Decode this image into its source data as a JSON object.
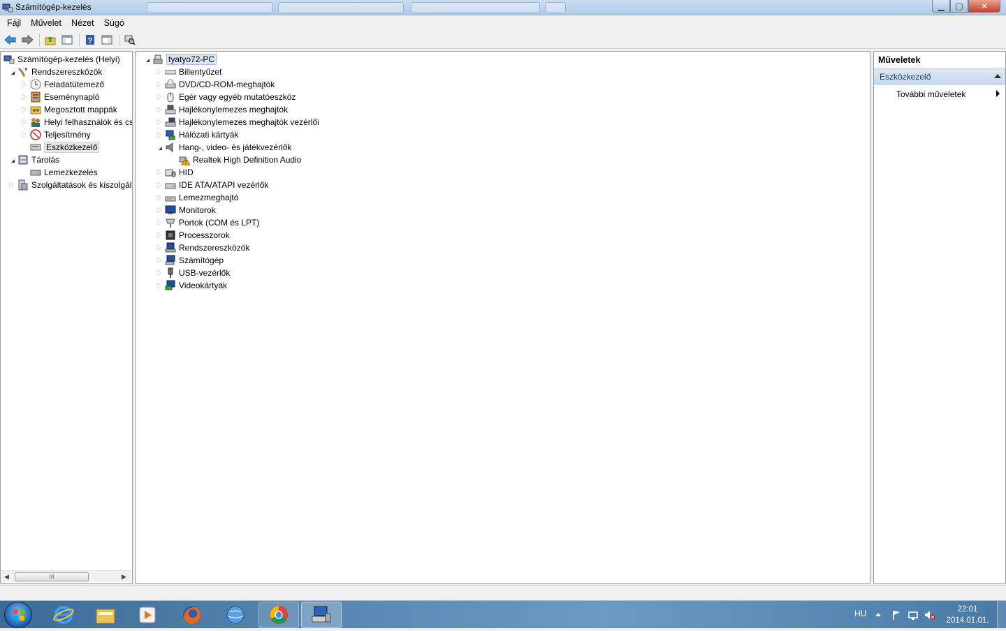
{
  "window": {
    "title": "Számítógép-kezelés",
    "min_glyph": "▁",
    "max_glyph": "▢",
    "close_glyph": "✕"
  },
  "menu": [
    "Fájl",
    "Művelet",
    "Nézet",
    "Súgó"
  ],
  "toolbar": {
    "buttons": [
      "back-icon",
      "forward-icon",
      "up-folder-icon",
      "show-hide-console-tree-icon",
      "help-icon",
      "show-hide-action-pane-icon",
      "properties-scan-icon"
    ]
  },
  "left_tree": {
    "items": [
      {
        "label": "Számítógép-kezelés (Helyi)",
        "icon": "computer-management-icon"
      },
      {
        "label": "Rendszereszközök",
        "icon": "system-tools-icon"
      },
      {
        "label": "Feladatütemező",
        "icon": "task-scheduler-icon"
      },
      {
        "label": "Eseménynapló",
        "icon": "event-viewer-icon"
      },
      {
        "label": "Megosztott mappák",
        "icon": "shared-folders-icon"
      },
      {
        "label": "Helyi felhasználók és cs",
        "icon": "local-users-icon"
      },
      {
        "label": "Teljesítmény",
        "icon": "performance-icon"
      },
      {
        "label": "Eszközkezelő",
        "icon": "device-manager-icon"
      },
      {
        "label": "Tárolás",
        "icon": "storage-icon"
      },
      {
        "label": "Lemezkezelés",
        "icon": "disk-management-icon"
      },
      {
        "label": "Szolgáltatások és kiszolgáló",
        "icon": "services-icon"
      }
    ],
    "scroll_thumb": "III"
  },
  "device_tree": {
    "root": "tyatyo72-PC",
    "items": [
      {
        "label": "Billentyűzet",
        "icon": "keyboard-icon"
      },
      {
        "label": "DVD/CD-ROM-meghajtók",
        "icon": "dvd-drive-icon"
      },
      {
        "label": "Egér vagy egyéb mutatóeszköz",
        "icon": "mouse-icon"
      },
      {
        "label": "Hajlékonylemezes meghajtók",
        "icon": "floppy-drive-icon"
      },
      {
        "label": "Hajlékonylemezes meghajtók vezérlői",
        "icon": "floppy-controller-icon"
      },
      {
        "label": "Hálózati kártyák",
        "icon": "network-adapter-icon"
      },
      {
        "label": "Hang-, video- és játékvezérlők",
        "icon": "sound-icon"
      },
      {
        "label": "Realtek High Definition Audio",
        "icon": "warning-icon"
      },
      {
        "label": "HID",
        "icon": "hid-icon"
      },
      {
        "label": "IDE ATA/ATAPI vezérlők",
        "icon": "ide-controller-icon"
      },
      {
        "label": "Lemezmeghajtó",
        "icon": "disk-drive-icon"
      },
      {
        "label": "Monitorok",
        "icon": "monitor-icon"
      },
      {
        "label": "Portok (COM és LPT)",
        "icon": "port-icon"
      },
      {
        "label": "Processzorok",
        "icon": "processor-icon"
      },
      {
        "label": "Rendszereszközök",
        "icon": "system-device-icon"
      },
      {
        "label": "Számítógép",
        "icon": "computer-icon"
      },
      {
        "label": "USB-vezérlők",
        "icon": "usb-icon"
      },
      {
        "label": "Videokártyák",
        "icon": "display-adapter-icon"
      }
    ]
  },
  "actions": {
    "header": "Műveletek",
    "section": "Eszközkezelő",
    "more": "További műveletek"
  },
  "taskbar": {
    "apps": [
      "internet-explorer-icon",
      "explorer-icon",
      "media-player-icon",
      "firefox-icon",
      "network-globe-icon",
      "chrome-icon",
      "computer-management-icon"
    ],
    "active_app": "computer-management-icon",
    "lang": "HU",
    "time": "22:01",
    "date": "2014.01.01."
  },
  "colors": {
    "titlebar": "#b8cfea",
    "taskbar": "#4f80ad",
    "warning": "#f2c200",
    "selection": "#e6e6e6"
  }
}
